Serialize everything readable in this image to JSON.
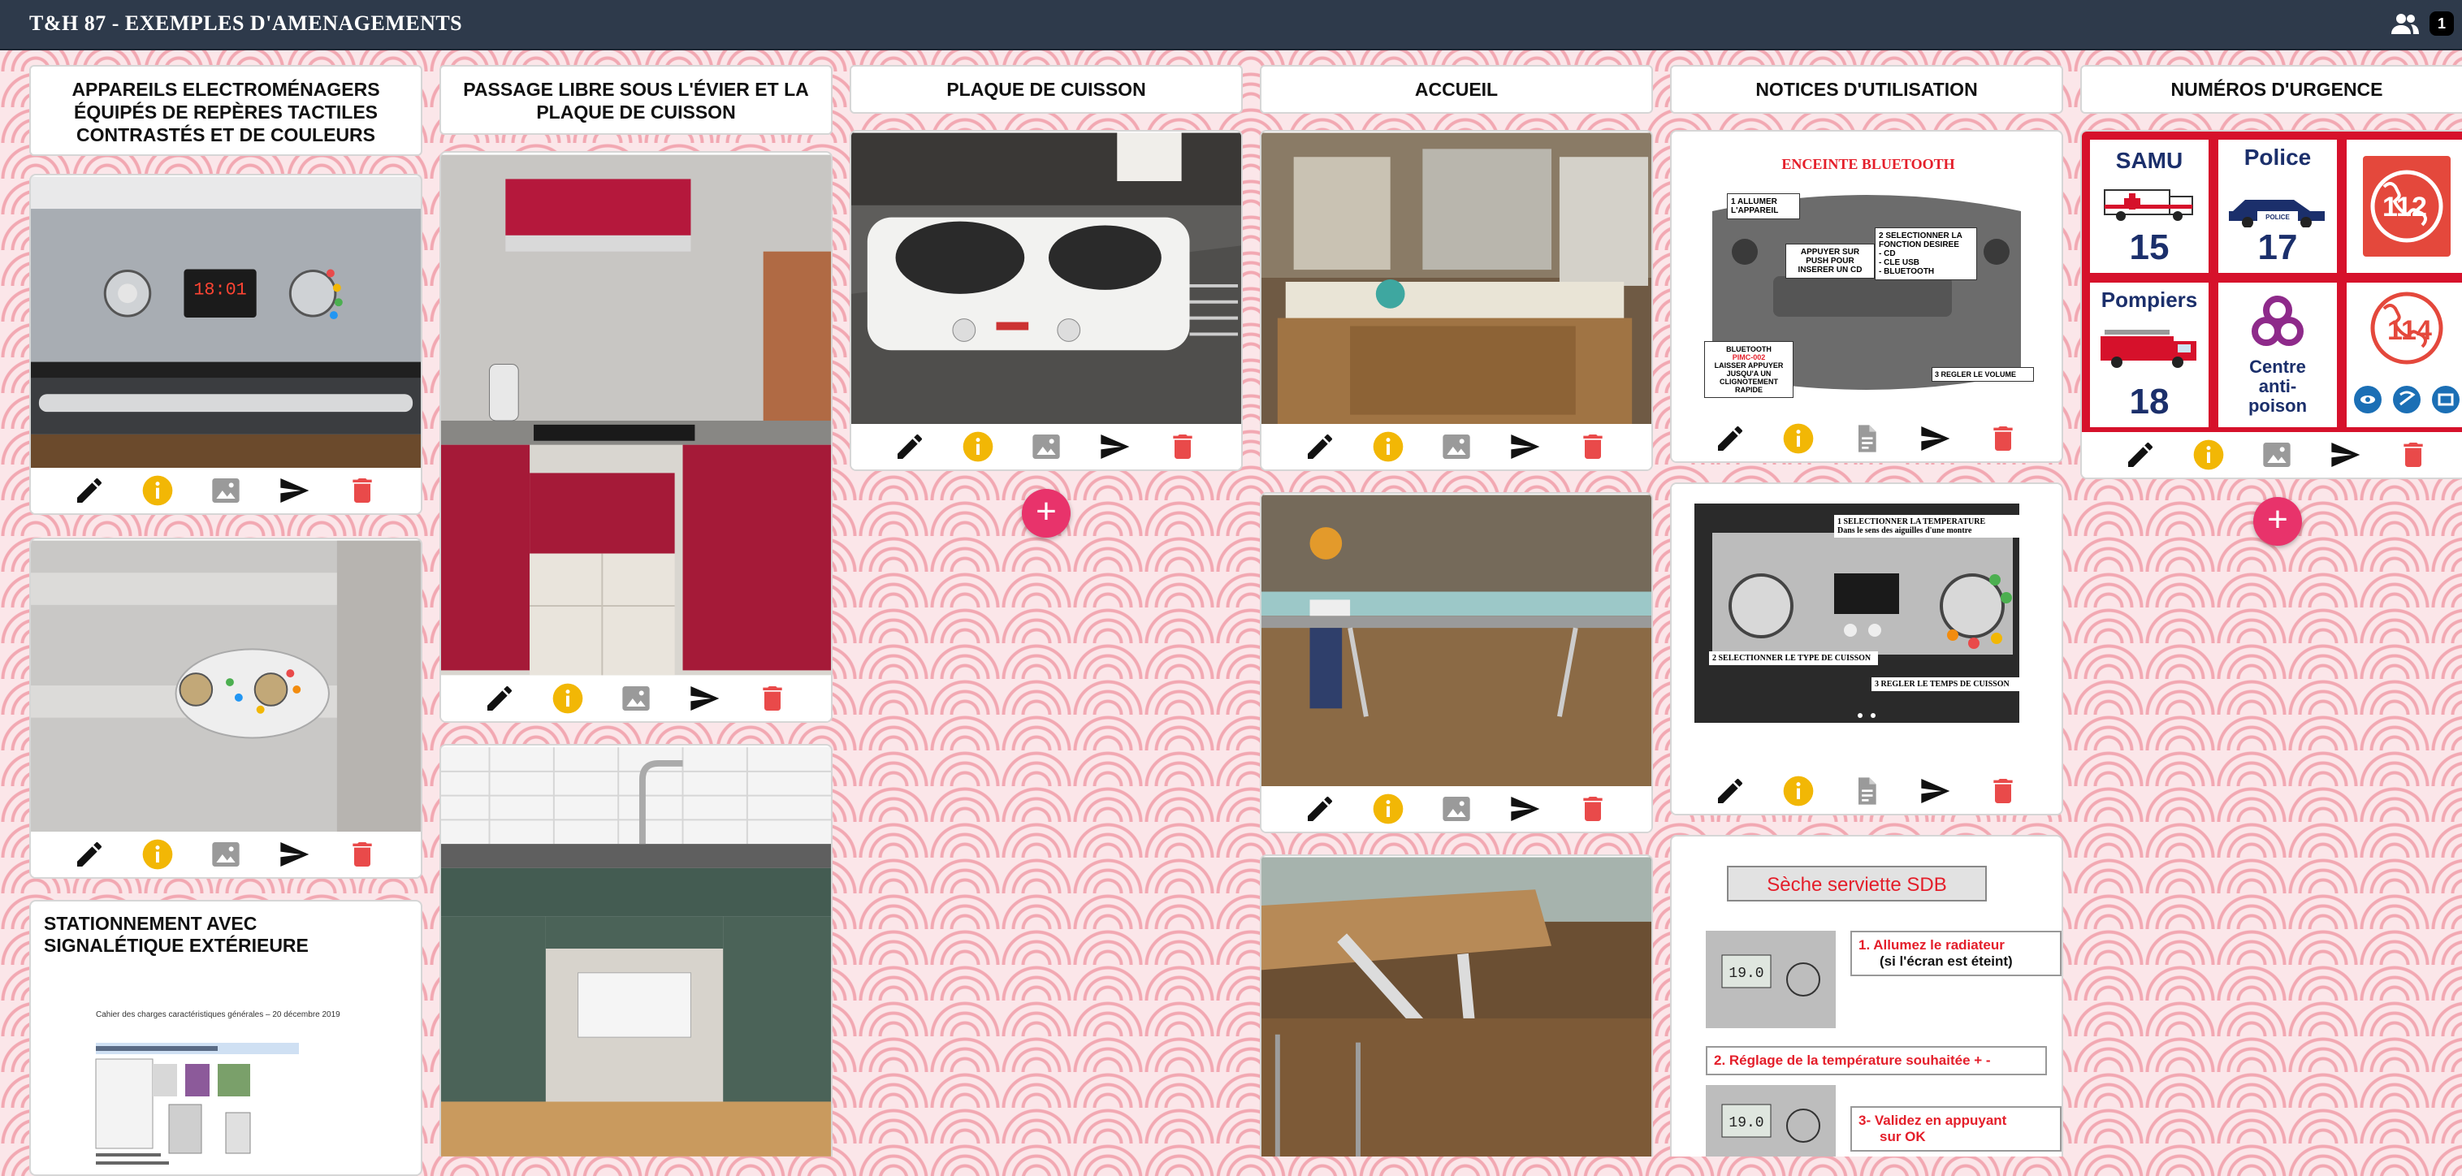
{
  "header": {
    "title": "T&H 87 - EXEMPLES D'AMENAGEMENTS",
    "notification_count": "1"
  },
  "colors": {
    "topbar": "#2e3a4b",
    "add_button": "#e8336b",
    "info": "#f2b705",
    "delete": "#e94a4a",
    "send": "#111111",
    "image_disabled": "#9a9a9a"
  },
  "columns": [
    {
      "title": "APPAREILS ELECTROMÉNAGERS ÉQUIPÉS DE REPÈRES TACTILES CONTRASTÉS ET DE COULEURS",
      "cards": [
        {
          "type": "photo",
          "subject": "oven control panel with tactile dots"
        },
        {
          "type": "photo",
          "subject": "radiator thermostat with coloured dots"
        },
        {
          "type": "text-card",
          "title": "STATIONNEMENT AVEC SIGNALÉTIQUE EXTÉRIEURE",
          "doc_caption": "Cahier des charges caractéristiques générales – 20 décembre 2019"
        }
      ]
    },
    {
      "title": "PASSAGE LIBRE SOUS L'ÉVIER ET LA PLAQUE DE CUISSON",
      "cards": [
        {
          "type": "photo",
          "subject": "red kitchen with free space under hob"
        },
        {
          "type": "photo",
          "subject": "green kitchen with free space under sink"
        }
      ]
    },
    {
      "title": "PLAQUE DE CUISSON",
      "cards": [
        {
          "type": "photo",
          "subject": "white double hot plate"
        }
      ]
    },
    {
      "title": "ACCUEIL",
      "cards": [
        {
          "type": "photo",
          "subject": "reception desk with displays"
        },
        {
          "type": "photo",
          "subject": "accessible reception counter"
        },
        {
          "type": "photo",
          "subject": "counter support bracket"
        }
      ]
    },
    {
      "title": "NOTICES D'UTILISATION",
      "cards": [
        {
          "type": "notice",
          "heading": "ENCEINTE BLUETOOTH",
          "labels": {
            "step1": "1 ALLUMER L'APPAREIL",
            "push": "APPUYER SUR PUSH POUR INSERER UN CD",
            "step2": "2 SELECTIONNER LA FONCTION DESIREE",
            "opt1": "- CD",
            "opt2": "- CLE USB",
            "opt3": "- BLUETOOTH",
            "bt": "BLUETOOTH",
            "pair": "PIMC-002",
            "hold": "LAISSER APPUYER JUSQU'A UN CLIGNOTEMENT RAPIDE",
            "step3": "3 REGLER LE VOLUME"
          }
        },
        {
          "type": "notice",
          "labels": {
            "step1": "1 SELECTIONNER LA TEMPERATURE",
            "step1b": "Dans le sens des aiguilles d'une montre",
            "step2": "2 SELECTIONNER LE TYPE DE CUISSON",
            "step3": "3 REGLER LE TEMPS DE CUISSON"
          }
        },
        {
          "type": "notice",
          "heading": "Sèche serviette SDB",
          "labels": {
            "step1": "1.  Allumez le radiateur",
            "step1b": "(si l'écran est éteint)",
            "step2": "2.  Réglage de la température souhaitée + -",
            "step3": "3-  Validez en appuyant",
            "step3b": "sur OK",
            "display": "19.0"
          }
        }
      ]
    },
    {
      "title": "NUMÉROS D'URGENCE",
      "cards": [
        {
          "type": "emergency",
          "tiles": [
            {
              "name": "SAMU",
              "number": "15"
            },
            {
              "name": "Police",
              "number": "17"
            },
            {
              "name": "",
              "number": "112"
            },
            {
              "name": "Pompiers",
              "number": "18"
            },
            {
              "name": "Centre anti-poison",
              "number": ""
            },
            {
              "name": "",
              "number": "114"
            }
          ],
          "badge": "POLICE"
        }
      ]
    }
  ]
}
